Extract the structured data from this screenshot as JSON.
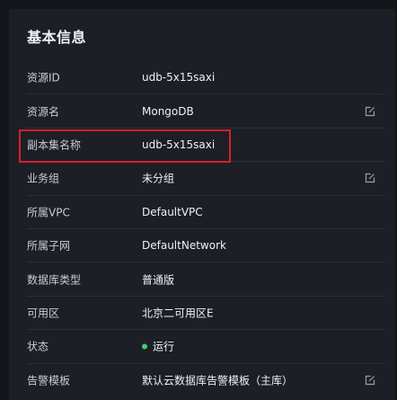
{
  "section": {
    "title": "基本信息"
  },
  "rows": [
    {
      "label": "资源ID",
      "value": "udb-5x15saxi",
      "editable": false
    },
    {
      "label": "资源名",
      "value": "MongoDB",
      "editable": true
    },
    {
      "label": "副本集名称",
      "value": "udb-5x15saxi",
      "editable": false
    },
    {
      "label": "业务组",
      "value": "未分组",
      "editable": true
    },
    {
      "label": "所属VPC",
      "value": "DefaultVPC",
      "editable": false
    },
    {
      "label": "所属子网",
      "value": "DefaultNetwork",
      "editable": false
    },
    {
      "label": "数据库类型",
      "value": "普通版",
      "editable": false
    },
    {
      "label": "可用区",
      "value": "北京二可用区E",
      "editable": false
    },
    {
      "label": "状态",
      "value": "运行",
      "editable": false,
      "status_color": "#3fd06a"
    },
    {
      "label": "告警模板",
      "value": "默认云数据库告警模板（主库）",
      "editable": true
    }
  ],
  "colors": {
    "background": "#15161b",
    "panel": "#1d1f26",
    "divider": "#2c2f37",
    "highlight_border": "#d81e2a",
    "status_running": "#3fd06a"
  },
  "icons": {
    "edit": "edit-icon"
  }
}
